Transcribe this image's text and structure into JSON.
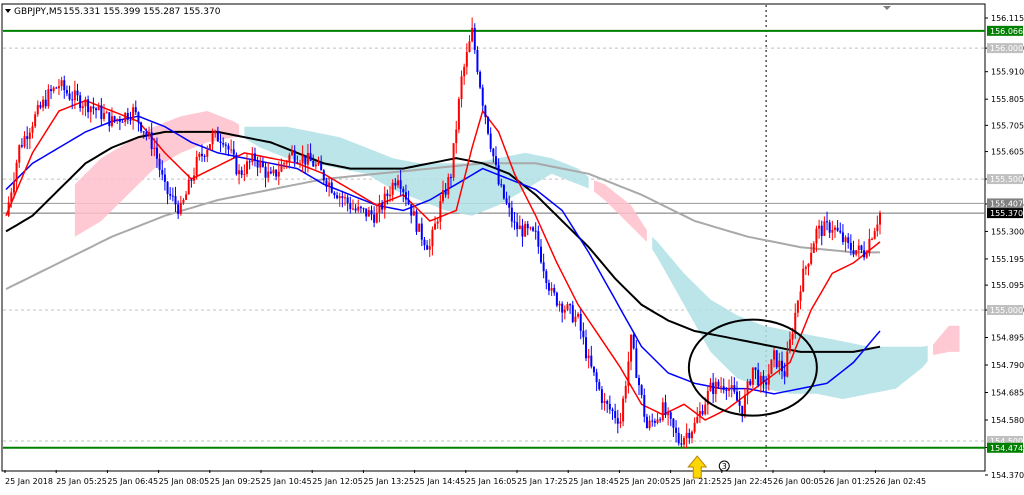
{
  "header": {
    "symbol": "GBPJPY,M5",
    "ohlc": "155.331 155.399 155.287 155.370"
  },
  "chart_data": {
    "type": "candlestick",
    "title": "GBPJPY,M5",
    "ylim": [
      154.43,
      156.16
    ],
    "y_ticks": [
      "156.115",
      "156.000",
      "155.910",
      "155.805",
      "155.705",
      "155.605",
      "155.500",
      "155.405",
      "155.300",
      "155.195",
      "155.095",
      "155.000",
      "154.895",
      "154.790",
      "154.685",
      "154.580",
      "154.475",
      "154.370"
    ],
    "x_ticks": [
      "25 Jan 2018",
      "25 Jan 05:25",
      "25 Jan 06:45",
      "25 Jan 08:05",
      "25 Jan 09:25",
      "25 Jan 10:45",
      "25 Jan 12:05",
      "25 Jan 13:25",
      "25 Jan 14:45",
      "25 Jan 16:05",
      "25 Jan 17:25",
      "25 Jan 18:45",
      "25 Jan 20:05",
      "25 Jan 21:25",
      "25 Jan 22:45",
      "26 Jan 00:05",
      "26 Jan 01:25",
      "26 Jan 02:45"
    ],
    "price_labels": [
      {
        "text": "156.066",
        "value": 156.066,
        "color": "#008000"
      },
      {
        "text": "156.000",
        "value": 156.0,
        "color": "#c0c0c0"
      },
      {
        "text": "155.500",
        "value": 155.5,
        "color": "#c0c0c0"
      },
      {
        "text": "155.407",
        "value": 155.407,
        "color": "#808080"
      },
      {
        "text": "155.370",
        "value": 155.37,
        "color": "#000000"
      },
      {
        "text": "155.000",
        "value": 155.0,
        "color": "#c0c0c0"
      },
      {
        "text": "154.500",
        "value": 154.5,
        "color": "#c0c0c0"
      },
      {
        "text": "154.474",
        "value": 154.474,
        "color": "#008000"
      }
    ],
    "horizontal_lines": {
      "resistance": 156.066,
      "support": 154.474,
      "round_levels": [
        156.0,
        155.5,
        155.0,
        154.5
      ],
      "bid": 155.37,
      "ask": 155.407
    },
    "series": [
      {
        "role": "price",
        "x": [
          0,
          5,
          10,
          16,
          20,
          24,
          32,
          40,
          48,
          56,
          60,
          66,
          72,
          78,
          82,
          88,
          94,
          100,
          108,
          116,
          124,
          132,
          140,
          148,
          156,
          160,
          164,
          168,
          172,
          176,
          180,
          186,
          192,
          200,
          206,
          212,
          216,
          220,
          226,
          232,
          236,
          242,
          248,
          254,
          260,
          266,
          272,
          278,
          282,
          286,
          290,
          294,
          300,
          306,
          312,
          318,
          324,
          330
        ],
        "y": [
          155.36,
          155.62,
          155.72,
          155.82,
          155.86,
          155.82,
          155.78,
          155.72,
          155.76,
          155.62,
          155.46,
          155.38,
          155.56,
          155.66,
          155.66,
          155.52,
          155.58,
          155.5,
          155.6,
          155.56,
          155.46,
          155.38,
          155.36,
          155.52,
          155.3,
          155.24,
          155.4,
          155.52,
          155.88,
          156.06,
          155.8,
          155.48,
          155.32,
          155.28,
          155.06,
          155.0,
          154.96,
          154.8,
          154.64,
          154.58,
          154.88,
          154.55,
          154.62,
          154.5,
          154.56,
          154.7,
          154.72,
          154.62,
          154.78,
          154.7,
          154.82,
          154.76,
          155.1,
          155.3,
          155.32,
          155.24,
          155.22,
          155.37
        ]
      },
      {
        "role": "ma-red",
        "x": [
          0,
          10,
          20,
          30,
          40,
          50,
          60,
          70,
          80,
          90,
          100,
          110,
          120,
          130,
          140,
          150,
          160,
          170,
          176,
          180,
          186,
          192,
          200,
          208,
          216,
          224,
          232,
          240,
          248,
          256,
          264,
          272,
          280,
          288,
          296,
          304,
          312,
          320,
          330
        ],
        "y": [
          155.36,
          155.6,
          155.76,
          155.8,
          155.76,
          155.72,
          155.6,
          155.5,
          155.55,
          155.6,
          155.58,
          155.56,
          155.52,
          155.46,
          155.4,
          155.44,
          155.34,
          155.38,
          155.62,
          155.76,
          155.68,
          155.52,
          155.36,
          155.18,
          155.02,
          154.9,
          154.78,
          154.64,
          154.6,
          154.64,
          154.58,
          154.62,
          154.68,
          154.74,
          154.8,
          155.0,
          155.14,
          155.18,
          155.26
        ]
      },
      {
        "role": "ma-blue",
        "x": [
          0,
          10,
          20,
          30,
          40,
          50,
          60,
          70,
          80,
          90,
          100,
          110,
          120,
          130,
          140,
          150,
          160,
          170,
          180,
          190,
          200,
          210,
          220,
          230,
          240,
          250,
          260,
          270,
          280,
          290,
          300,
          310,
          320,
          330
        ],
        "y": [
          155.46,
          155.56,
          155.62,
          155.68,
          155.72,
          155.74,
          155.7,
          155.64,
          155.6,
          155.58,
          155.56,
          155.54,
          155.48,
          155.44,
          155.4,
          155.38,
          155.42,
          155.48,
          155.54,
          155.5,
          155.46,
          155.38,
          155.22,
          155.04,
          154.86,
          154.76,
          154.72,
          154.7,
          154.7,
          154.68,
          154.7,
          154.72,
          154.8,
          154.92
        ]
      },
      {
        "role": "ma-black",
        "x": [
          0,
          10,
          20,
          30,
          40,
          50,
          60,
          70,
          80,
          90,
          100,
          110,
          120,
          130,
          140,
          150,
          160,
          170,
          180,
          190,
          200,
          210,
          220,
          230,
          240,
          250,
          260,
          270,
          280,
          290,
          300,
          310,
          320,
          330
        ],
        "y": [
          155.3,
          155.36,
          155.46,
          155.56,
          155.62,
          155.66,
          155.68,
          155.68,
          155.68,
          155.66,
          155.64,
          155.6,
          155.56,
          155.54,
          155.54,
          155.54,
          155.56,
          155.58,
          155.56,
          155.52,
          155.44,
          155.34,
          155.24,
          155.12,
          155.02,
          154.96,
          154.92,
          154.9,
          154.88,
          154.86,
          154.84,
          154.84,
          154.84,
          154.86
        ]
      },
      {
        "role": "ma-gray",
        "x": [
          0,
          20,
          40,
          60,
          80,
          100,
          120,
          140,
          160,
          180,
          200,
          220,
          240,
          260,
          280,
          300,
          320,
          330
        ],
        "y": [
          155.08,
          155.18,
          155.28,
          155.36,
          155.42,
          155.46,
          155.5,
          155.52,
          155.54,
          155.56,
          155.56,
          155.52,
          155.44,
          155.34,
          155.28,
          155.24,
          155.22,
          155.22
        ]
      }
    ],
    "annotations": {
      "circle_center": {
        "x": 282,
        "y": 154.78
      },
      "arrow_x": 261,
      "marker": "3",
      "vline_x": 287
    }
  }
}
